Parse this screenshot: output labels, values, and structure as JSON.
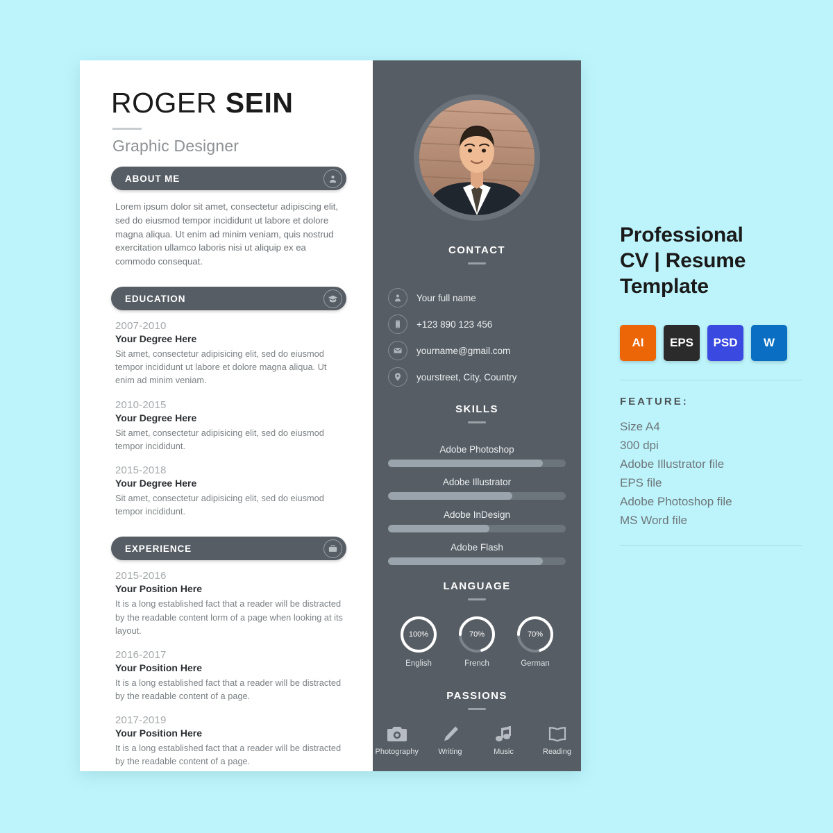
{
  "theme": {
    "page_bg": "#bdf4fb",
    "panel_dark": "#565d64",
    "panel_light": "#ffffff",
    "accent_muted": "#9aa4ad"
  },
  "resume": {
    "name_first": "ROGER ",
    "name_last": "SEIN",
    "job_title": "Graphic Designer",
    "about": {
      "label": "ABOUT ME",
      "icon": "person-icon",
      "text": "Lorem ipsum dolor sit amet, consectetur adipiscing elit, sed do eiusmod tempor incididunt ut labore et dolore magna aliqua. Ut enim ad minim veniam, quis nostrud exercitation ullamco laboris nisi ut aliquip ex ea commodo consequat."
    },
    "education": {
      "label": "EDUCATION",
      "icon": "graduation-cap-icon",
      "entries": [
        {
          "date": "2007-2010",
          "title": "Your Degree Here",
          "desc": "Sit amet, consectetur adipisicing elit, sed do eiusmod tempor incididunt ut labore et dolore magna aliqua. Ut enim ad minim veniam."
        },
        {
          "date": "2010-2015",
          "title": "Your Degree Here",
          "desc": "Sit amet, consectetur adipisicing elit, sed do eiusmod tempor incididunt."
        },
        {
          "date": "2015-2018",
          "title": "Your Degree Here",
          "desc": "Sit amet, consectetur adipisicing elit, sed do eiusmod tempor incididunt."
        }
      ]
    },
    "experience": {
      "label": "EXPERIENCE",
      "icon": "briefcase-icon",
      "entries": [
        {
          "date": "2015-2016",
          "title": "Your Position Here",
          "desc": "It is a long established fact that a reader will be distracted by the readable content lorm of a page when looking at its layout."
        },
        {
          "date": "2016-2017",
          "title": "Your Position Here",
          "desc": "It is a long established fact that a reader will be distracted by the readable content of a page."
        },
        {
          "date": "2017-2019",
          "title": "Your Position Here",
          "desc": "It is a long established fact that a reader will be distracted by the readable content of a page."
        }
      ]
    },
    "photo_alt": "portrait-photo",
    "contact": {
      "heading": "CONTACT",
      "rows": [
        {
          "icon": "person-icon",
          "text": "Your full name"
        },
        {
          "icon": "phone-icon",
          "text": "+123 890 123 456"
        },
        {
          "icon": "envelope-icon",
          "text": "yourname@gmail.com"
        },
        {
          "icon": "location-pin-icon",
          "text": "yourstreet, City, Country"
        }
      ]
    },
    "skills": {
      "heading": "SKILLS",
      "items": [
        {
          "name": "Adobe Photoshop",
          "value": 87
        },
        {
          "name": "Adobe Illustrator",
          "value": 70
        },
        {
          "name": "Adobe InDesign",
          "value": 57
        },
        {
          "name": "Adobe Flash",
          "value": 87
        }
      ]
    },
    "language": {
      "heading": "LANGUAGE",
      "items": [
        {
          "name": "English",
          "value": 100,
          "display": "100%"
        },
        {
          "name": "French",
          "value": 70,
          "display": "70%"
        },
        {
          "name": "German",
          "value": 70,
          "display": "70%"
        }
      ]
    },
    "passions": {
      "heading": "PASSIONS",
      "items": [
        {
          "icon": "camera-icon",
          "label": "Photography"
        },
        {
          "icon": "pencil-icon",
          "label": "Writing"
        },
        {
          "icon": "music-note-icon",
          "label": "Music"
        },
        {
          "icon": "open-book-icon",
          "label": "Reading"
        }
      ]
    }
  },
  "promo": {
    "title_lines": [
      "Professional",
      "CV | Resume",
      "Template"
    ],
    "badges": [
      {
        "label": "AI",
        "color": "#ec6608"
      },
      {
        "label": "EPS",
        "color": "#2b2b2b"
      },
      {
        "label": "PSD",
        "color": "#3a49e0"
      },
      {
        "label": "W",
        "color": "#0a6fc2"
      }
    ],
    "feature_heading": "FEATURE:",
    "features": [
      "Size A4",
      "300 dpi",
      "Adobe Illustrator file",
      "EPS file",
      "Adobe Photoshop file",
      "MS Word file"
    ]
  }
}
